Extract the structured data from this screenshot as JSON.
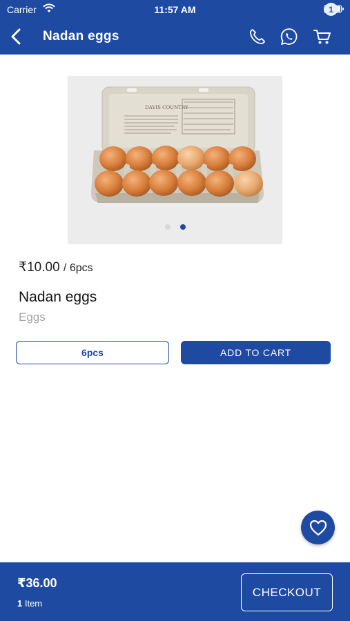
{
  "status_bar": {
    "carrier": "Carrier",
    "time": "11:57 AM"
  },
  "nav": {
    "title": "Nadan eggs",
    "cart_badge": "1",
    "icons": [
      "back-arrow-icon",
      "phone-icon",
      "whatsapp-icon",
      "cart-icon"
    ]
  },
  "product": {
    "carton_brand_text": "DAVIS COUNTRY",
    "image_slides": 2,
    "active_slide": 2,
    "price": "₹10.00",
    "unit": "/ 6pcs",
    "name": "Nadan eggs",
    "category": "Eggs",
    "variant_label": "6pcs",
    "add_to_cart_label": "ADD TO CART"
  },
  "favorite_icon": "heart-outline-icon",
  "cart_summary": {
    "total": "₹36.00",
    "item_count": "1",
    "item_label": " Item",
    "checkout_label": "CHECKOUT"
  },
  "colors": {
    "primary": "#1f4aa1",
    "background": "#ffffff",
    "muted_text": "#a7a7a7"
  }
}
